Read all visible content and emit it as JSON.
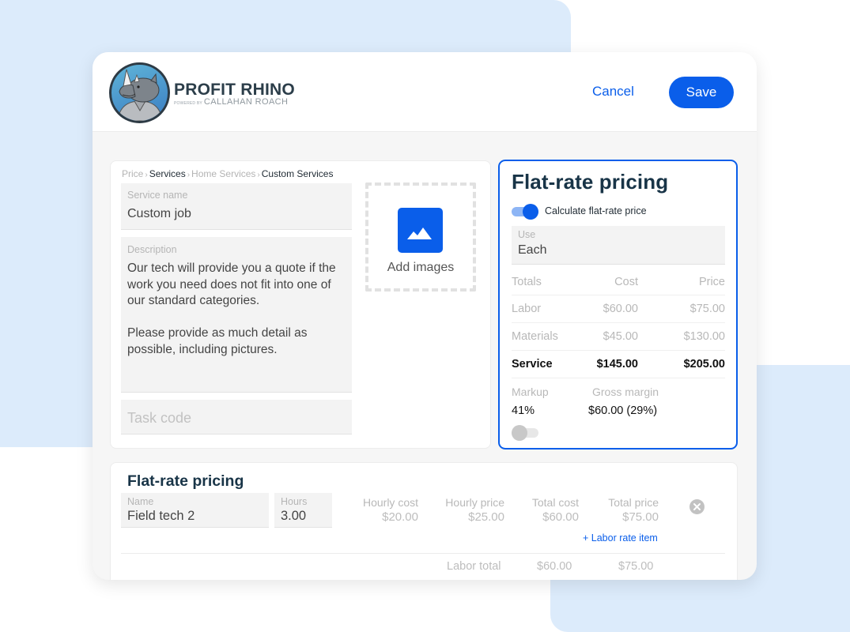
{
  "colors": {
    "accent": "#0a5eea",
    "background_blocks": "#dcebfb",
    "heading": "#183447"
  },
  "header": {
    "logo": {
      "icon": "rhino-mascot-icon",
      "title": "PROFIT RHINO",
      "powered_by": "POWERED BY",
      "company": "CALLAHAN ROACH"
    },
    "cancel_label": "Cancel",
    "save_label": "Save"
  },
  "breadcrumb": [
    {
      "label": "Price",
      "current": false
    },
    {
      "label": "Services",
      "current": true
    },
    {
      "label": "Home Services",
      "current": false
    },
    {
      "label": "Custom Services",
      "current": true
    }
  ],
  "breadcrumb_separator": "›",
  "service_form": {
    "service_name": {
      "label": "Service name",
      "value": "Custom job"
    },
    "description": {
      "label": "Description",
      "value": "Our tech will provide you a quote if the work you need does not fit into one of our standard categories.\n\nPlease provide as much detail as possible, including pictures."
    },
    "task_code": {
      "placeholder": "Task code",
      "value": ""
    },
    "add_images": {
      "icon": "image-mountain-icon",
      "label": "Add images"
    }
  },
  "pricing_panel": {
    "title": "Flat-rate pricing",
    "calculate_toggle": {
      "label": "Calculate flat-rate price",
      "on": true
    },
    "use": {
      "label": "Use",
      "value": "Each"
    },
    "totals": {
      "headers": [
        "Totals",
        "Cost",
        "Price"
      ],
      "rows": [
        {
          "label": "Labor",
          "cost": "$60.00",
          "price": "$75.00"
        },
        {
          "label": "Materials",
          "cost": "$45.00",
          "price": "$130.00"
        },
        {
          "label": "Service",
          "cost": "$145.00",
          "price": "$205.00"
        }
      ]
    },
    "markup": {
      "label": "Markup",
      "value": "41%"
    },
    "gross_margin": {
      "label": "Gross margin",
      "value": "$60.00 (29%)"
    },
    "secondary_toggle": {
      "on": false
    }
  },
  "labor_section": {
    "title": "Flat-rate pricing",
    "item": {
      "name": {
        "label": "Name",
        "value": "Field tech 2"
      },
      "hours": {
        "label": "Hours",
        "value": "3.00"
      },
      "hourly_cost": {
        "label": "Hourly cost",
        "value": "$20.00"
      },
      "hourly_price": {
        "label": "Hourly price",
        "value": "$25.00"
      },
      "total_cost": {
        "label": "Total cost",
        "value": "$60.00"
      },
      "total_price": {
        "label": "Total price",
        "value": "$75.00"
      },
      "remove_icon": "close-circle-icon"
    },
    "add_item_label": "+ Labor rate item",
    "labor_total": {
      "label": "Labor total",
      "cost": "$60.00",
      "price": "$75.00"
    }
  }
}
